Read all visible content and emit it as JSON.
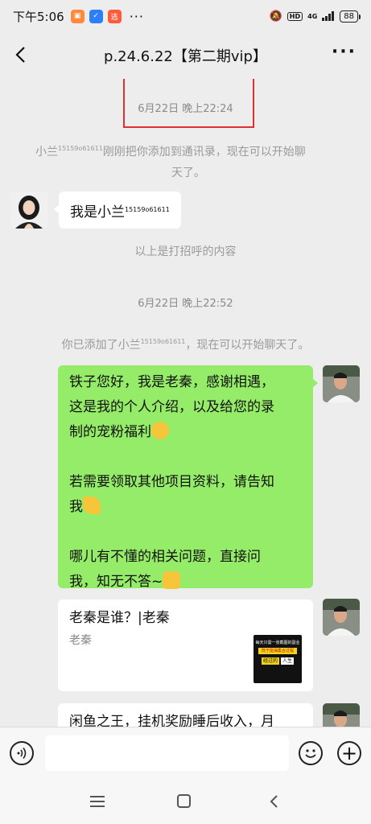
{
  "status_bar": {
    "time": "下午5:06",
    "dots": "···",
    "hd": "HD",
    "network": "4G",
    "battery": "88"
  },
  "header": {
    "title": "p.24.6.22【第二期vip】",
    "back_icon": "chevron-left-icon",
    "more_icon": "more-dots-icon"
  },
  "messages": {
    "ts1": "6月22日 晚上22:24",
    "sys1_line1_a": "小兰",
    "sys1_line1_num": "15159o61611",
    "sys1_line1_b": "刚刚把你添加到通讯录，现在可以开始聊",
    "sys1_line2": "天了。",
    "bubble1_text": "我是小兰",
    "bubble1_num": "15159o61611",
    "sys2": "以上是打招呼的内容",
    "ts2": "6月22日 晚上22:52",
    "sys3_a": "你已添加了小兰",
    "sys3_num": "15159o61611",
    "sys3_b": "，现在可以开始聊天了。",
    "bubble2_l1": "铁子您好，我是老秦，感谢相遇，",
    "bubble2_l2": "这是我的个人介绍，以及给您的录",
    "bubble2_l3": "制的宠粉福利",
    "bubble2_l4": "若需要领取其他项目资料，请告知",
    "bubble2_l5": "我",
    "bubble2_l6": "哪儿有不懂的相关问题，直接问",
    "bubble2_l7": "我，知无不答~",
    "card1_title": "老秦是谁？|老秦",
    "card1_sub": "老秦",
    "card1_thumb_l1": "每天只需一张截图的副业",
    "card1_thumb_l2": "既于能抽集合过程",
    "card1_thumb_l3": "经过的",
    "card1_thumb_l4": "人生",
    "card2_title": "闲鱼之王，挂机奖励睡后收入，月"
  },
  "input_bar": {
    "voice_icon": "voice-icon",
    "emoji_icon": "emoji-icon",
    "plus_icon": "plus-icon",
    "plus_symbol": "+"
  },
  "nav_bar": {
    "menu_icon": "menu-icon",
    "home_icon": "home-icon",
    "back_icon": "back-icon"
  },
  "colors": {
    "bubble_green": "#95ec69",
    "highlight_box": "#e03030"
  }
}
